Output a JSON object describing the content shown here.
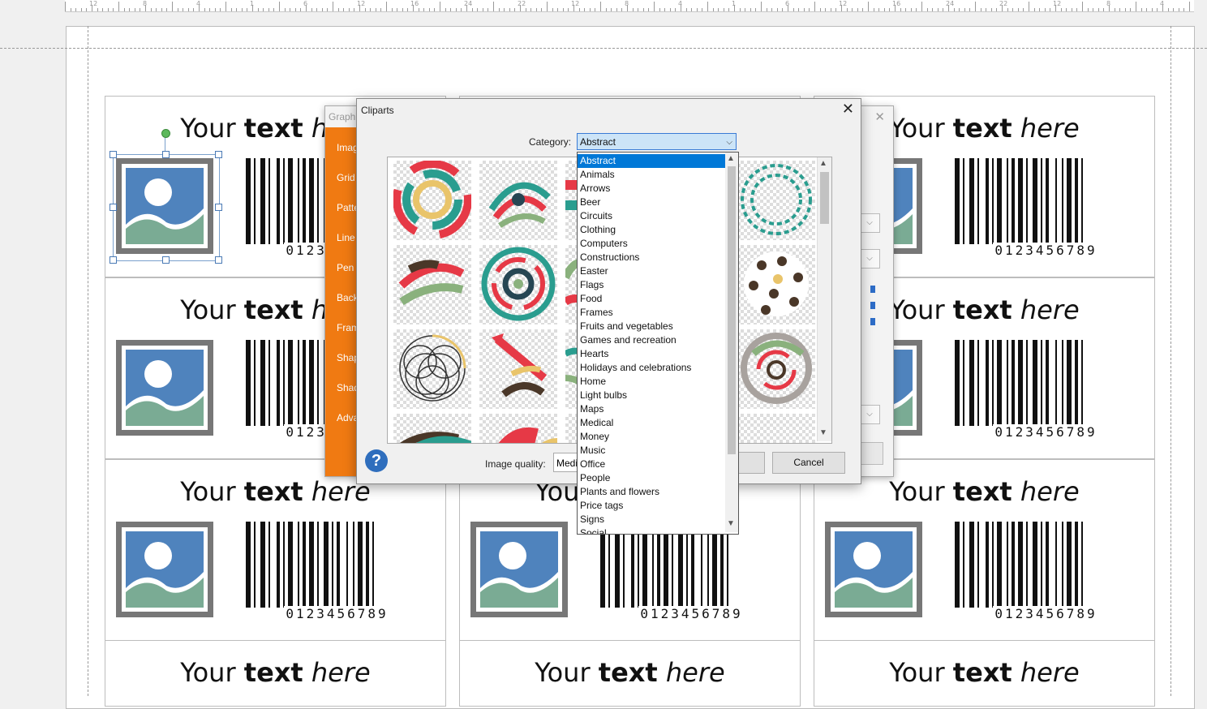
{
  "ruler": {
    "numbers": [
      "12",
      "8",
      "4",
      "1",
      "6",
      "12",
      "16",
      "24",
      "22",
      "12",
      "8",
      "4",
      "1",
      "6",
      "12",
      "16",
      "24",
      "22",
      "12",
      "8",
      "4"
    ]
  },
  "labels": {
    "text_normal": "Your ",
    "text_bold": "text",
    "text_italic": " here",
    "barcode_number": "0123456789"
  },
  "graphics_dialog": {
    "title": "Graphics",
    "side_items": [
      "Image",
      "Grid",
      "Pattern",
      "Line",
      "Pen",
      "Background",
      "Frame",
      "Shape",
      "Shadow",
      "Advanced"
    ],
    "close": "✕"
  },
  "cliparts_dialog": {
    "title": "Cliparts",
    "close": "✕",
    "category_label": "Category:",
    "category_value": "Abstract",
    "help": "?",
    "image_quality_label": "Image quality:",
    "image_quality_value": "Medium",
    "cancel_label": "Cancel",
    "categories": [
      "Abstract",
      "Animals",
      "Arrows",
      "Beer",
      "Circuits",
      "Clothing",
      "Computers",
      "Constructions",
      "Easter",
      "Flags",
      "Food",
      "Frames",
      "Fruits and vegetables",
      "Games and recreation",
      "Hearts",
      "Holidays and celebrations",
      "Home",
      "Light bulbs",
      "Maps",
      "Medical",
      "Money",
      "Music",
      "Office",
      "People",
      "Plants and flowers",
      "Price tags",
      "Signs",
      "Social"
    ],
    "selected_category_index": 0
  },
  "colors": {
    "accent_orange": "#f07a12",
    "selection_blue": "#0078d7",
    "image_frame": "#777777",
    "image_sky": "#4f83bd",
    "image_hill": "#7aab94"
  }
}
